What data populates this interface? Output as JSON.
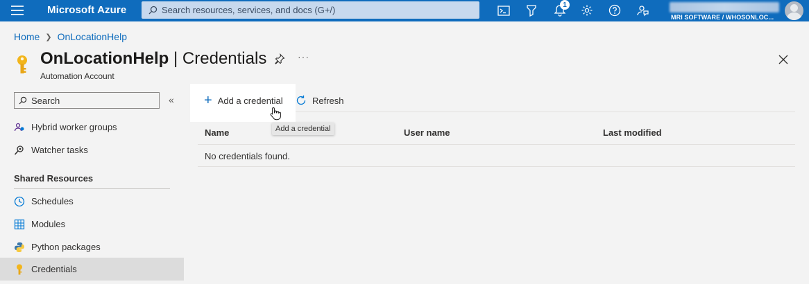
{
  "topbar": {
    "brand": "Microsoft Azure",
    "search_placeholder": "Search resources, services, and docs (G+/)",
    "notification_count": "1",
    "directory": "MRI SOFTWARE / WHOSONLOC...",
    "color": "#0f6cbd"
  },
  "breadcrumb": {
    "home": "Home",
    "current": "OnLocationHelp"
  },
  "header": {
    "resource": "OnLocationHelp",
    "separator": "|",
    "page": "Credentials",
    "subtitle": "Automation Account",
    "more": "···"
  },
  "sidebar": {
    "search_placeholder": "Search",
    "collapse": "«",
    "items_top": [
      {
        "label": "Hybrid worker groups",
        "icon": "hybrid-worker-icon"
      },
      {
        "label": "Watcher tasks",
        "icon": "watcher-icon"
      }
    ],
    "section": "Shared Resources",
    "items_shared": [
      {
        "label": "Schedules",
        "icon": "clock-icon"
      },
      {
        "label": "Modules",
        "icon": "modules-icon"
      },
      {
        "label": "Python packages",
        "icon": "python-icon"
      },
      {
        "label": "Credentials",
        "icon": "key-icon",
        "active": true
      }
    ]
  },
  "toolbar": {
    "add_label": "Add a credential",
    "refresh_label": "Refresh",
    "tooltip": "Add a credential"
  },
  "table": {
    "columns": [
      "Name",
      "User name",
      "Last modified"
    ],
    "empty_message": "No credentials found."
  }
}
